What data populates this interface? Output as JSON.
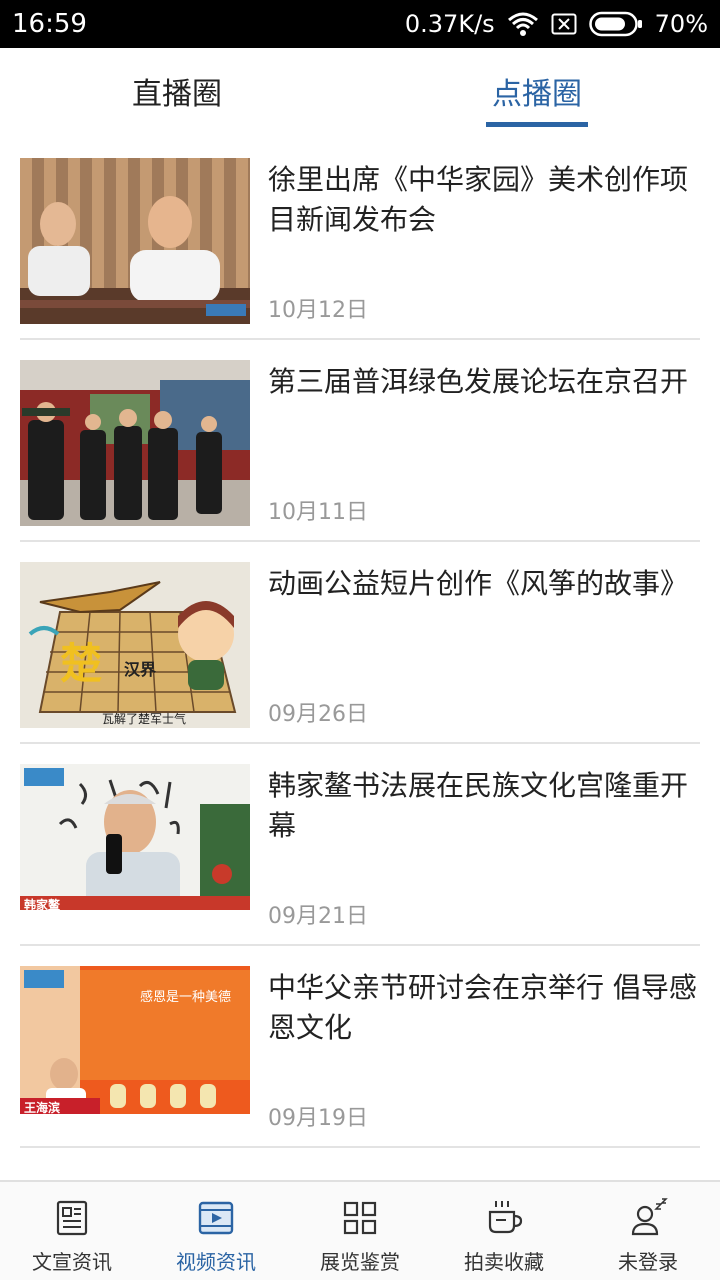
{
  "status_bar": {
    "time": "16:59",
    "speed": "0.37K/s",
    "battery": "70%"
  },
  "tabs": [
    {
      "label": "直播圈",
      "active": false
    },
    {
      "label": "点播圈",
      "active": true
    }
  ],
  "accent_color": "#2b64a4",
  "news": [
    {
      "title": "徐里出席《中华家园》美术创作项目新闻发布会",
      "date": "10月12日",
      "thumb": "meeting"
    },
    {
      "title": "第三届普洱绿色发展论坛在京召开",
      "date": "10月11日",
      "thumb": "exhibition"
    },
    {
      "title": "动画公益短片创作《风筝的故事》",
      "date": "09月26日",
      "thumb": "cartoon-chess"
    },
    {
      "title": "韩家鳌书法展在民族文化宫隆重开幕",
      "date": "09月21日",
      "thumb": "calligraphy-interview"
    },
    {
      "title": "中华父亲节研讨会在京举行 倡导感恩文化",
      "date": "09月19日",
      "thumb": "red-stage"
    }
  ],
  "thumb_text": {
    "cartoon_caption": "瓦解了楚军士气",
    "cartoon_char": "楚",
    "cartoon_han": "汉界",
    "calligraphy_name": "韩家鳌",
    "stage_banner": "感恩是一种美德",
    "stage_name": "王海滨"
  },
  "bottom_nav": [
    {
      "label": "文宣资讯",
      "icon": "newspaper-icon",
      "active": false
    },
    {
      "label": "视频资讯",
      "icon": "video-icon",
      "active": true
    },
    {
      "label": "展览鉴赏",
      "icon": "grid-icon",
      "active": false
    },
    {
      "label": "拍卖收藏",
      "icon": "coffee-cup-icon",
      "active": false
    },
    {
      "label": "未登录",
      "icon": "user-sleep-icon",
      "active": false
    }
  ]
}
